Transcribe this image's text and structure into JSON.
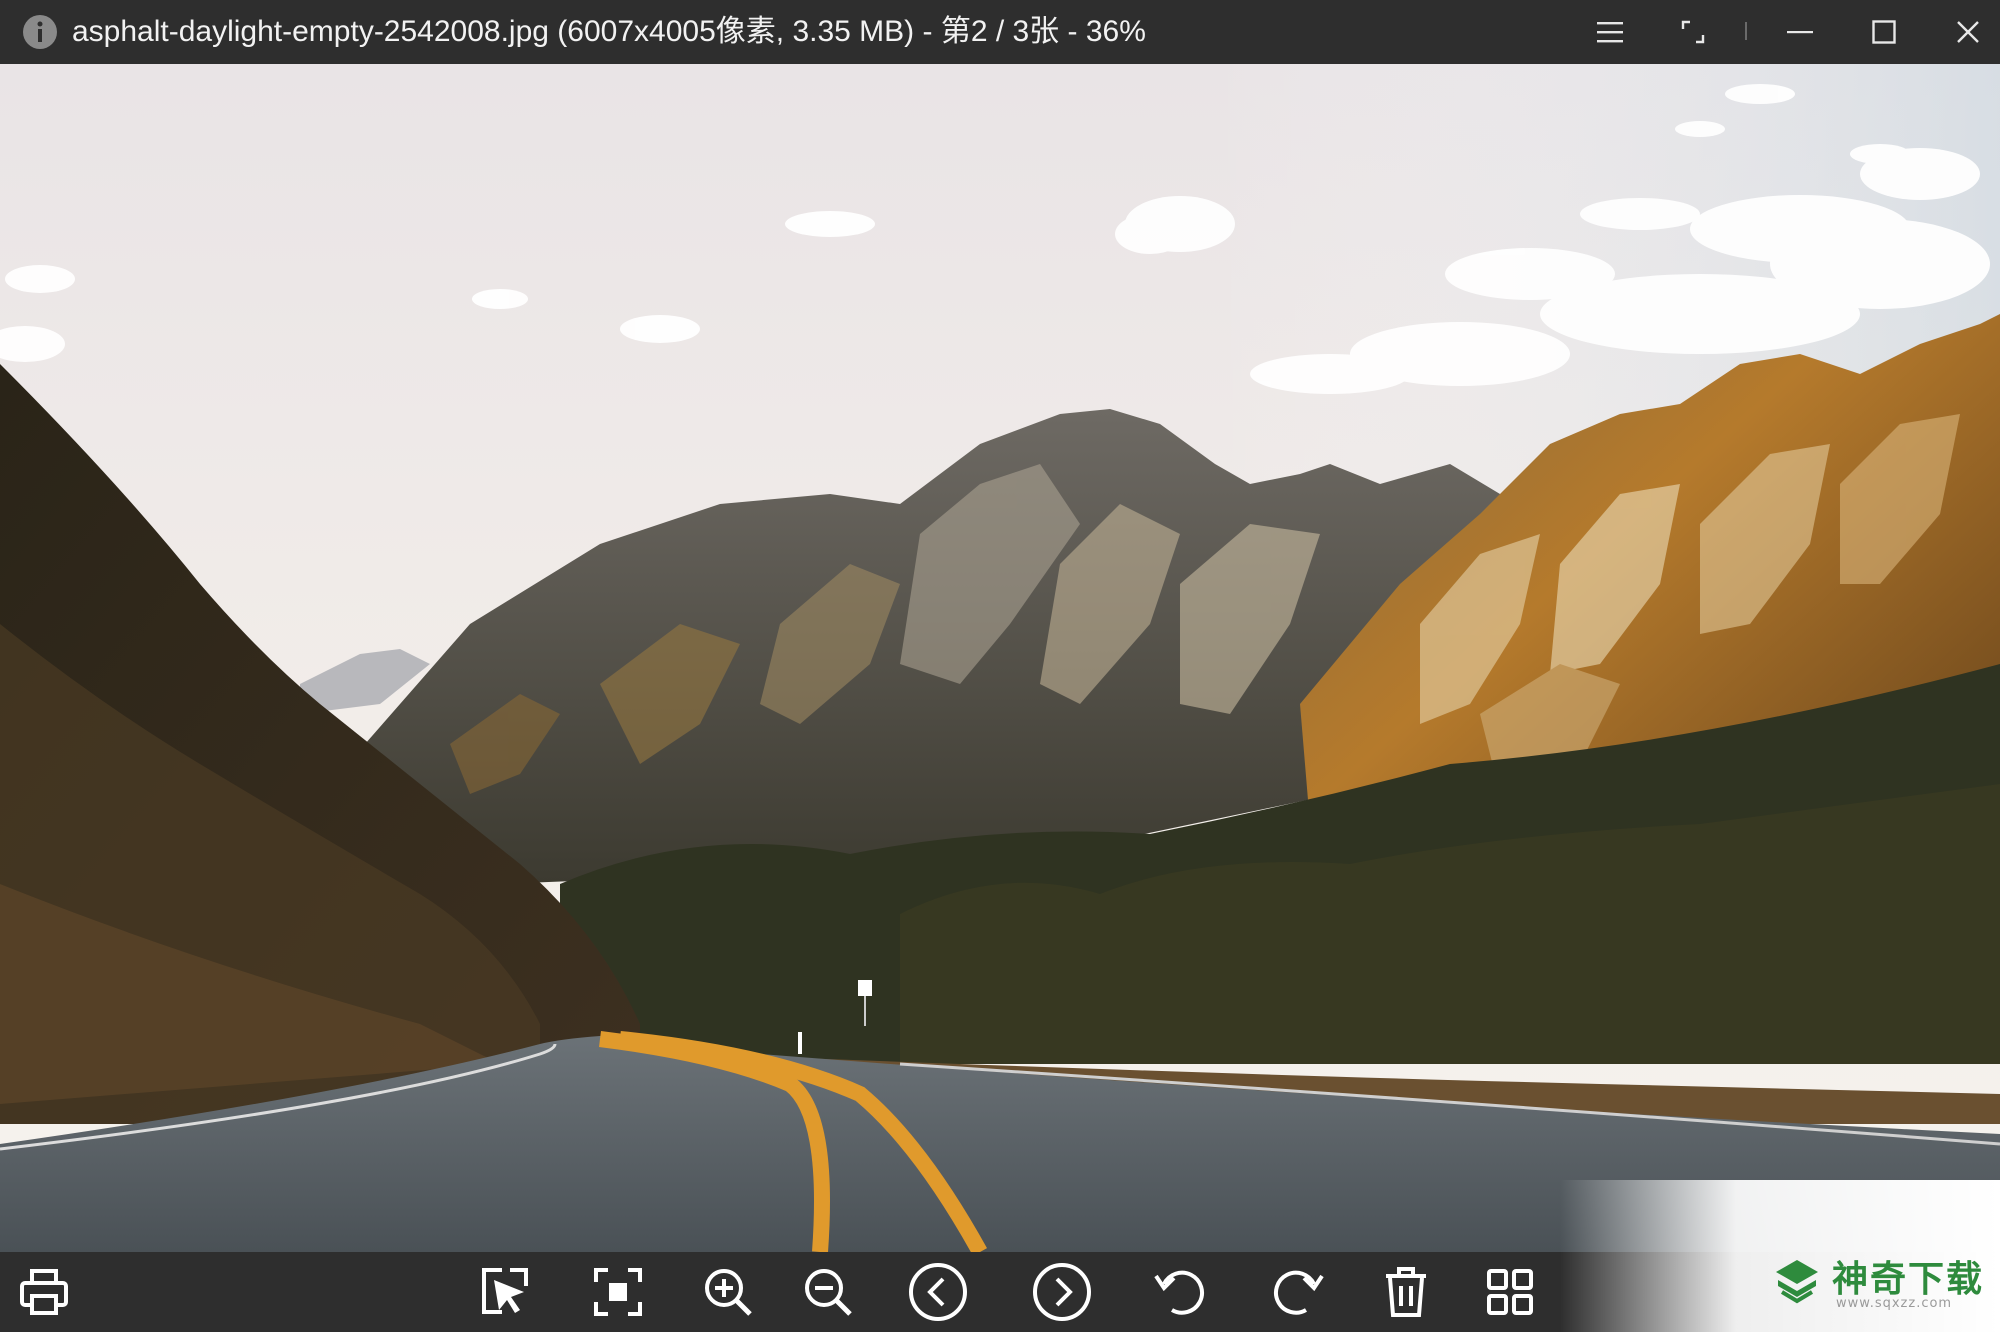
{
  "titlebar": {
    "title": "asphalt-daylight-empty-2542008.jpg (6007x4005像素, 3.35 MB) - 第2 / 3张 - 36%",
    "info_icon": "info-icon",
    "buttons": [
      "menu-icon",
      "fullscreen-icon",
      "minimize-icon",
      "maximize-icon",
      "close-icon"
    ]
  },
  "viewer": {
    "image_description_icon": "photo-image"
  },
  "toolbar": {
    "buttons": [
      "print-icon",
      "select-cursor-icon",
      "fit-screen-icon",
      "zoom-in-icon",
      "zoom-out-icon",
      "previous-icon",
      "next-icon",
      "rotate-left-icon",
      "rotate-right-icon",
      "delete-icon",
      "grid-view-icon"
    ]
  },
  "watermark": {
    "brand": "神奇下载",
    "url": "www.sqxzz.com"
  },
  "colors": {
    "chrome_bg": "#2e2e2e",
    "icon_fg": "#ffffff",
    "brand_green": "#2e8b3d"
  }
}
